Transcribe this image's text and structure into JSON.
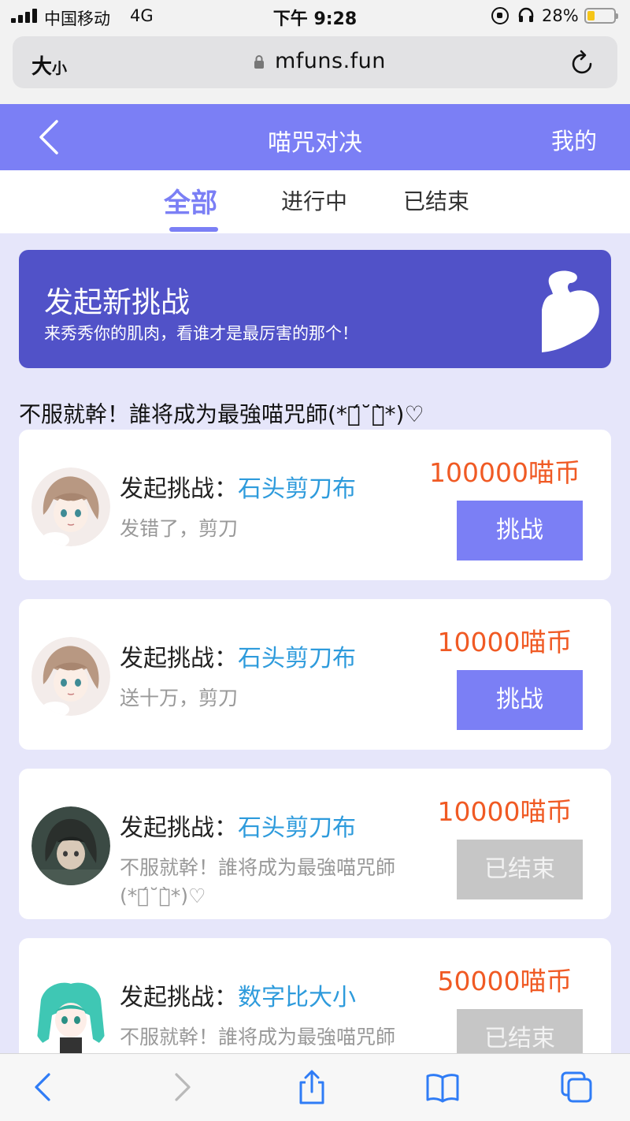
{
  "status_bar": {
    "carrier": "中国移动",
    "network": "4G",
    "time": "下午 9:28",
    "battery_percent": "28%",
    "battery_level": 0.28,
    "icons": [
      "signal-icon",
      "orientation-lock-icon",
      "headphones-icon",
      "battery-icon"
    ]
  },
  "browser": {
    "text_size_big": "大",
    "text_size_small": "小",
    "url": "mfuns.fun",
    "icons": [
      "lock-icon",
      "reload-icon"
    ]
  },
  "header": {
    "title": "喵咒对决",
    "mine": "我的",
    "back_icon": "chevron-left-icon"
  },
  "tabs": [
    {
      "label": "全部",
      "active": true
    },
    {
      "label": "进行中",
      "active": false
    },
    {
      "label": "已结束",
      "active": false
    }
  ],
  "banner": {
    "title": "发起新挑战",
    "subtitle": "来秀秀你的肌肉，看谁才是最厉害的那个！",
    "icon": "flexed-bicep-icon"
  },
  "slogan": "不服就幹！誰将成为最強喵咒師(*ค́˘ค̀*)♡",
  "cards": [
    {
      "prefix": "发起挑战：",
      "game": "石头剪刀布",
      "message": "发错了，剪刀",
      "amount": "100000喵币",
      "button": "挑战",
      "status": "active",
      "avatar": "avatar-anime-girl-brown-hair"
    },
    {
      "prefix": "发起挑战：",
      "game": "石头剪刀布",
      "message": "送十万，剪刀",
      "amount": "10000喵币",
      "button": "挑战",
      "status": "active",
      "avatar": "avatar-anime-girl-brown-hair"
    },
    {
      "prefix": "发起挑战：",
      "game": "石头剪刀布",
      "message": "不服就幹！誰将成为最強喵咒師(*ค́˘ค̀*)♡",
      "amount": "10000喵币",
      "button": "已结束",
      "status": "ended",
      "avatar": "avatar-anime-dark-hair"
    },
    {
      "prefix": "发起挑战：",
      "game": "数字比大小",
      "message": "不服就幹！誰将成为最強喵咒師(*ค́˘ค̀*)♡",
      "amount": "50000喵币",
      "button": "已结束",
      "status": "ended",
      "avatar": "avatar-anime-teal-hair"
    }
  ],
  "toolbar": {
    "icons": [
      "back-arrow-icon",
      "forward-arrow-icon",
      "share-icon",
      "bookmarks-icon",
      "tabs-icon"
    ]
  },
  "colors": {
    "accent": "#7b7ff5",
    "banner": "#5152c8",
    "amount": "#f05a24",
    "game_link": "#2e9bdc",
    "ended_button": "#c6c6c6",
    "background": "#e6e6fa"
  }
}
